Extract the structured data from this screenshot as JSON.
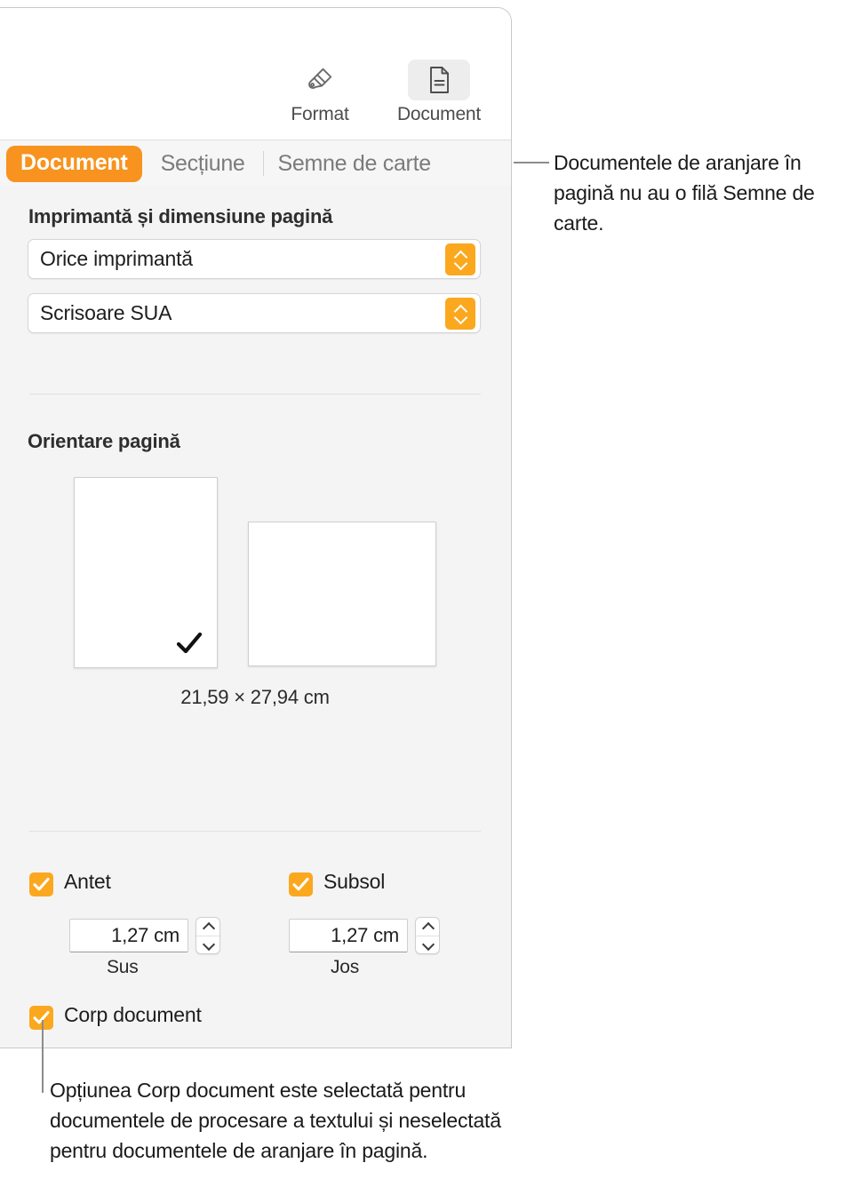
{
  "toolbar": {
    "buttons": [
      {
        "label": "Format",
        "icon": "paintbrush-icon",
        "active": false
      },
      {
        "label": "Document",
        "icon": "document-icon",
        "active": true
      }
    ]
  },
  "tabs": [
    {
      "label": "Document",
      "selected": true
    },
    {
      "label": "Secțiune",
      "selected": false
    },
    {
      "label": "Semne de carte",
      "selected": false
    }
  ],
  "printer_section": {
    "title": "Imprimantă și dimensiune pagină",
    "printer_value": "Orice imprimantă",
    "page_size_value": "Scrisoare SUA"
  },
  "orientation_section": {
    "title": "Orientare pagină",
    "portrait_selected": true,
    "landscape_selected": false,
    "size_label": "21,59 × 27,94 cm"
  },
  "headers_section": {
    "header_checkbox_label": "Antet",
    "header_checked": true,
    "footer_checkbox_label": "Subsol",
    "footer_checked": true,
    "top_value": "1,27 cm",
    "top_caption": "Sus",
    "bottom_value": "1,27 cm",
    "bottom_caption": "Jos",
    "body_checkbox_label": "Corp document",
    "body_checked": true
  },
  "callouts": {
    "top": "Documentele de aranjare în pagină nu au o filă Semne de carte.",
    "bottom": "Opțiunea Corp document este selectată pentru documentele de procesare a textului și neselectată pentru documentele de aranjare în pagină."
  },
  "colors": {
    "accent_orange": "#f7931e",
    "control_orange": "#fba81e",
    "panel_background": "#f4f4f4",
    "toolbar_background": "#ffffff"
  }
}
